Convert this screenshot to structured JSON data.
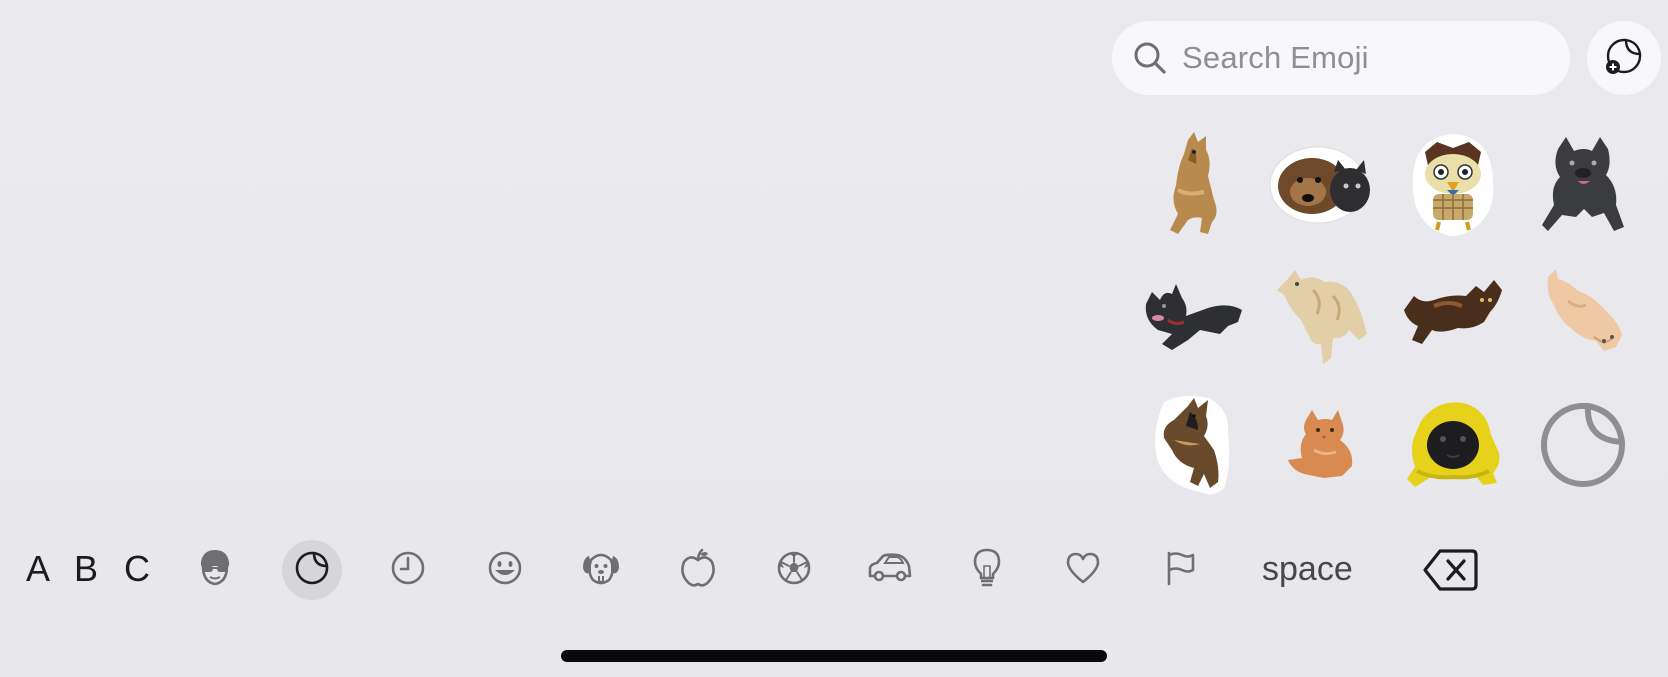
{
  "search": {
    "placeholder": "Search Emoji"
  },
  "stickers": [
    {
      "name": "sticker-dog-standing",
      "desc": "tan dog"
    },
    {
      "name": "sticker-dog-faces",
      "desc": "two dog faces"
    },
    {
      "name": "sticker-owl",
      "desc": "owl character"
    },
    {
      "name": "sticker-bulldog-running",
      "desc": "dark bulldog"
    },
    {
      "name": "sticker-bulldog-lying",
      "desc": "bulldog lying"
    },
    {
      "name": "sticker-cat-jumping",
      "desc": "cream cat"
    },
    {
      "name": "sticker-cat-stretching",
      "desc": "brown cat"
    },
    {
      "name": "sticker-cat-lying",
      "desc": "orange cat lying"
    },
    {
      "name": "sticker-shepherd-dog",
      "desc": "german shepherd"
    },
    {
      "name": "sticker-cat-sitting",
      "desc": "orange cat"
    },
    {
      "name": "sticker-pug-raincoat",
      "desc": "pug yellow raincoat"
    },
    {
      "name": "sticker-placeholder",
      "desc": "sticker outline"
    }
  ],
  "categories": [
    {
      "id": "memoji",
      "icon": "memoji-icon"
    },
    {
      "id": "stickers",
      "icon": "sticker-icon",
      "selected": true
    },
    {
      "id": "recent",
      "icon": "clock-icon"
    },
    {
      "id": "smileys",
      "icon": "smiley-icon"
    },
    {
      "id": "animals",
      "icon": "dog-icon"
    },
    {
      "id": "food",
      "icon": "apple-icon"
    },
    {
      "id": "activity",
      "icon": "soccer-ball-icon"
    },
    {
      "id": "travel",
      "icon": "car-icon"
    },
    {
      "id": "objects",
      "icon": "lightbulb-icon"
    },
    {
      "id": "symbols",
      "icon": "heart-icon"
    },
    {
      "id": "flags",
      "icon": "flag-icon"
    }
  ],
  "keys": {
    "abc_label": "A B C",
    "space_label": "space",
    "delete_icon": "delete-icon"
  },
  "colors": {
    "background": "#e9e9ed",
    "search_bg": "#f8f8fa",
    "selected_category_bg": "#d5d5da",
    "icon_gray": "#6e6e73"
  }
}
